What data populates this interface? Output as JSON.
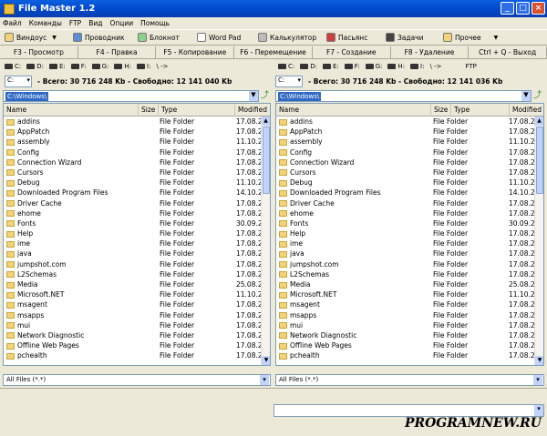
{
  "window": {
    "title": "File Master 1.2",
    "min": "_",
    "max": "□",
    "close": "×"
  },
  "menu": [
    "Файл",
    "Команды",
    "FTP",
    "Вид",
    "Опции",
    "Помощь"
  ],
  "toolbar": [
    {
      "label": "Виндоус",
      "icon": "folder-icon",
      "dropdown": true
    },
    {
      "label": "Проводник",
      "icon": "explorer-icon"
    },
    {
      "label": "Блокнот",
      "icon": "notepad-icon"
    },
    {
      "label": "Word Pad",
      "icon": "wordpad-icon"
    },
    {
      "label": "Калькулятор",
      "icon": "calculator-icon"
    },
    {
      "label": "Пасьянс",
      "icon": "solitaire-icon"
    },
    {
      "label": "Задачи",
      "icon": "tasks-icon"
    },
    {
      "label": "Прочее",
      "icon": "folder-icon",
      "dropdown": true
    }
  ],
  "fkeys": [
    "F3 - Просмотр",
    "F4 - Правка",
    "F5 - Копирование",
    "F6 - Перемещение",
    "F7 - Создание",
    "F8 - Удаление",
    "Ctrl + Q - Выход"
  ],
  "left": {
    "drives": [
      "C:",
      "D:",
      "E:",
      "F:",
      "G:",
      "H:",
      "I:",
      "\\ ->"
    ],
    "drive": "C:",
    "free": "- Всего: 30 716 248 Kb - Свободно: 12 141 040 Kb",
    "path": "C:\\Windows\\",
    "filter": "All Files (*.*)"
  },
  "right": {
    "drives": [
      "C:",
      "D:",
      "E:",
      "F:",
      "G:",
      "H:",
      "I:",
      "\\ ->",
      "FTP"
    ],
    "drive": "C:",
    "free": "- Всего: 30 716 248 Kb - Свободно: 12 141 036 Kb",
    "path": "C:\\Windows\\",
    "filter": "All Files (*.*)"
  },
  "columns": [
    "Name",
    "Size",
    "Type",
    "Modified"
  ],
  "files": [
    {
      "name": "addins",
      "type": "File Folder",
      "mod": "17.08.20"
    },
    {
      "name": "AppPatch",
      "type": "File Folder",
      "mod": "17.08.20"
    },
    {
      "name": "assembly",
      "type": "File Folder",
      "mod": "11.10.20"
    },
    {
      "name": "Config",
      "type": "File Folder",
      "mod": "17.08.20"
    },
    {
      "name": "Connection Wizard",
      "type": "File Folder",
      "mod": "17.08.20"
    },
    {
      "name": "Cursors",
      "type": "File Folder",
      "mod": "17.08.20"
    },
    {
      "name": "Debug",
      "type": "File Folder",
      "mod": "11.10.20"
    },
    {
      "name": "Downloaded Program Files",
      "type": "File Folder",
      "mod": "14.10.20"
    },
    {
      "name": "Driver Cache",
      "type": "File Folder",
      "mod": "17.08.20"
    },
    {
      "name": "ehome",
      "type": "File Folder",
      "mod": "17.08.20"
    },
    {
      "name": "Fonts",
      "type": "File Folder",
      "mod": "30.09.20"
    },
    {
      "name": "Help",
      "type": "File Folder",
      "mod": "17.08.20"
    },
    {
      "name": "ime",
      "type": "File Folder",
      "mod": "17.08.20"
    },
    {
      "name": "java",
      "type": "File Folder",
      "mod": "17.08.20"
    },
    {
      "name": "jumpshot.com",
      "type": "File Folder",
      "mod": "17.08.20"
    },
    {
      "name": "L2Schemas",
      "type": "File Folder",
      "mod": "17.08.20"
    },
    {
      "name": "Media",
      "type": "File Folder",
      "mod": "25.08.20"
    },
    {
      "name": "Microsoft.NET",
      "type": "File Folder",
      "mod": "11.10.20"
    },
    {
      "name": "msagent",
      "type": "File Folder",
      "mod": "17.08.20"
    },
    {
      "name": "msapps",
      "type": "File Folder",
      "mod": "17.08.20"
    },
    {
      "name": "mui",
      "type": "File Folder",
      "mod": "17.08.20"
    },
    {
      "name": "Network Diagnostic",
      "type": "File Folder",
      "mod": "17.08.20"
    },
    {
      "name": "Offline Web Pages",
      "type": "File Folder",
      "mod": "17.08.20"
    },
    {
      "name": "pchealth",
      "type": "File Folder",
      "mod": "17.08.20"
    }
  ],
  "watermark": "PROGRAMNEW.RU"
}
